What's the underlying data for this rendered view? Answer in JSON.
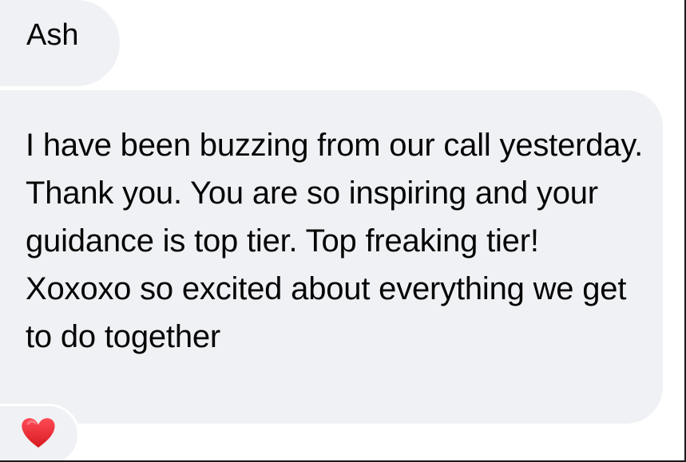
{
  "conversation": {
    "sender_name": "Ash",
    "message": "I have been buzzing from our call yesterday. Thank you.  You are so inspiring and your guidance is top tier. Top freaking tier! Xoxoxo so excited about everything we get to do together",
    "reaction_icon": "heart-icon"
  },
  "colors": {
    "bubble": "#f0f1f4",
    "text": "#050505",
    "heart": "#e5232b",
    "background": "#ffffff"
  }
}
